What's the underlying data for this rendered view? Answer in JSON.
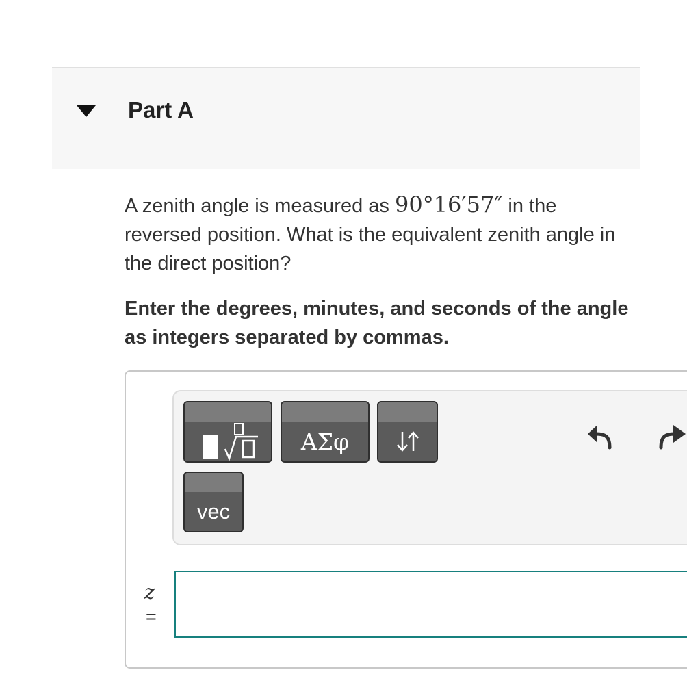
{
  "part": {
    "title": "Part A",
    "toggle_icon": "caret-down-icon"
  },
  "question": {
    "prefix": "A zenith angle is measured as ",
    "angle": "90°16′57″",
    "suffix": " in the reversed position. What is the equivalent zenith angle in the direct position?"
  },
  "instruction": "Enter the degrees, minutes, and seconds of the angle as integers separated by commas.",
  "toolbar": {
    "templates_icon": "fraction-sqrt-template-icon",
    "greek_label": "ΑΣφ",
    "arrows_icon": "up-down-arrows-icon",
    "vec_label": "vec",
    "undo_icon": "undo-arrow-icon",
    "redo_icon": "redo-arrow-icon"
  },
  "answer": {
    "variable": "z",
    "equals": "=",
    "value": ""
  },
  "colors": {
    "input_border": "#17807e",
    "button_face": "#5b5b5b",
    "header_bg": "#f7f7f7"
  }
}
